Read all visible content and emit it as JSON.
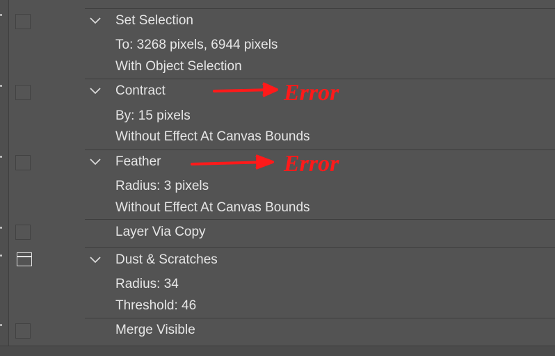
{
  "actions": [
    {
      "title": "Set Selection",
      "details": [
        "To: 3268 pixels, 6944 pixels",
        "With Object Selection"
      ]
    },
    {
      "title": "Contract",
      "details": [
        "By: 15 pixels",
        "Without Effect At Canvas Bounds"
      ]
    },
    {
      "title": "Feather",
      "details": [
        "Radius: 3 pixels",
        "Without Effect At Canvas Bounds"
      ]
    },
    {
      "title": "Layer Via Copy",
      "details": []
    },
    {
      "title": "Dust & Scratches",
      "details": [
        "Radius: 34",
        "Threshold: 46"
      ]
    },
    {
      "title": "Merge Visible",
      "details": []
    }
  ],
  "annotations": {
    "contract_note": "Error",
    "feather_note": "Error",
    "color": "#ff1a1a"
  },
  "icons": {
    "expand": "chevron-down-icon",
    "dialog": "dialog-toggle-icon"
  }
}
